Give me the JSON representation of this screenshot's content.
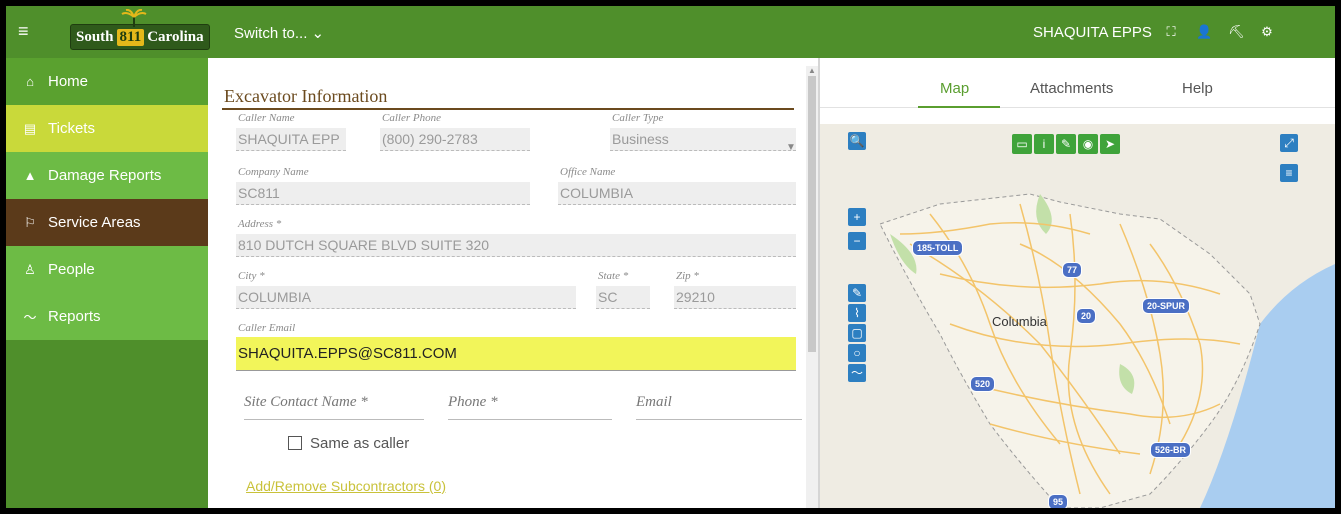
{
  "topbar": {
    "logo_text_left": "South",
    "logo_text_num": "811",
    "logo_text_right": "Carolina",
    "switch_label": "Switch to... ⌄",
    "user_name": "SHAQUITA EPPS"
  },
  "sidebar": {
    "items": [
      {
        "label": "Home",
        "icon": "home-icon"
      },
      {
        "label": "Tickets",
        "icon": "document-icon"
      },
      {
        "label": "Damage Reports",
        "icon": "cone-icon"
      },
      {
        "label": "Service Areas",
        "icon": "flag-icon"
      },
      {
        "label": "People",
        "icon": "person-icon"
      },
      {
        "label": "Reports",
        "icon": "chart-icon"
      }
    ]
  },
  "form": {
    "title": "Excavator Information",
    "caller_name_label": "Caller Name",
    "caller_name": "SHAQUITA EPP",
    "caller_phone_label": "Caller Phone",
    "caller_phone": "(800) 290-2783",
    "caller_type_label": "Caller Type",
    "caller_type": "Business",
    "company_label": "Company Name",
    "company": "SC811",
    "office_label": "Office Name",
    "office": "COLUMBIA",
    "address_label": "Address *",
    "address": "810 DUTCH SQUARE BLVD SUITE 320",
    "city_label": "City *",
    "city": "COLUMBIA",
    "state_label": "State *",
    "state": "SC",
    "zip_label": "Zip *",
    "zip": "29210",
    "email_label": "Caller Email",
    "email": "SHAQUITA.EPPS@SC811.COM",
    "site_contact_placeholder": "Site Contact Name *",
    "phone_placeholder": "Phone *",
    "site_email_placeholder": "Email",
    "same_as_caller": "Same as caller",
    "subcontractors_link": "Add/Remove Subcontractors (0)"
  },
  "right_panel": {
    "tabs": [
      "Map",
      "Attachments",
      "Help"
    ],
    "active_tab": "Map"
  },
  "map": {
    "city_label": "Columbia",
    "shields": [
      "185-TOLL",
      "77",
      "20",
      "20-SPUR",
      "520",
      "526-BR",
      "95"
    ],
    "colors": {
      "water": "#a9cdf0",
      "land": "#f1efe6",
      "roads": "#f3c46a",
      "parks": "#c3e0a9",
      "state_fill": "#f6f3ea"
    }
  },
  "colors": {
    "topbar": "#4f8f2b",
    "sidebar": "#5aa12f",
    "tickets_active": "#c9d93a",
    "service_areas": "#5b3a1a",
    "title": "#6b4a1e",
    "email_highlight": "#f2f55a",
    "map_button": "#2d7fc1",
    "map_tool_button": "#3fa33a"
  }
}
